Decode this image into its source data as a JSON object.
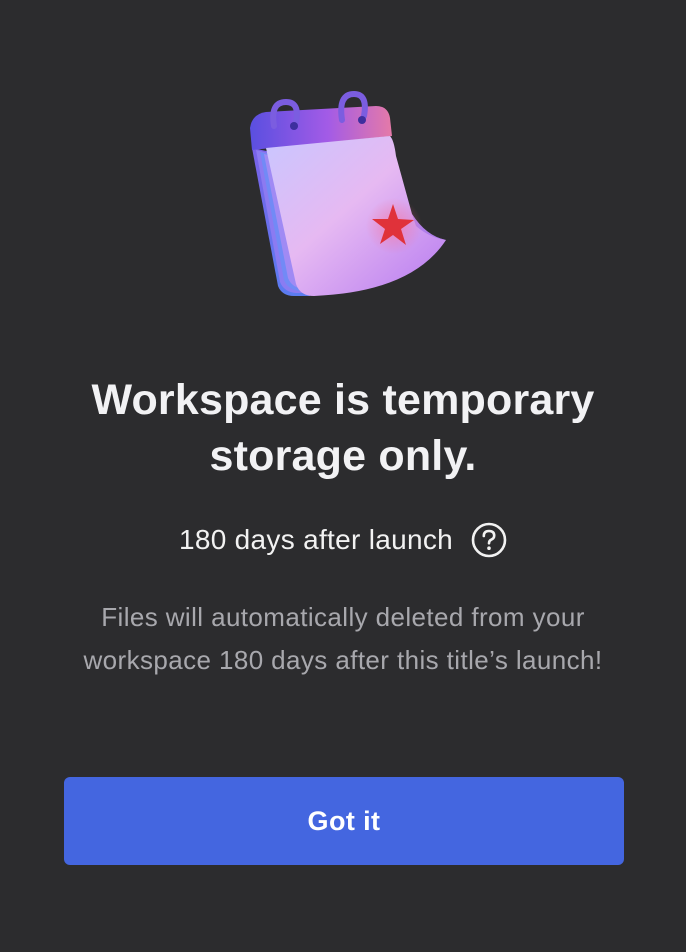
{
  "dialog": {
    "illustration_icon": "calendar-icon",
    "title": "Workspace is temporary storage only.",
    "subtitle": "180 days after launch",
    "help_icon": "question-circle-icon",
    "description": "Files will automatically deleted from your workspace 180 days after this title’s launch!",
    "primary_button_label": "Got it"
  },
  "colors": {
    "background": "#2c2c2e",
    "primary_button": "#4466e0",
    "title_text": "#f2f2f4",
    "description_text": "#a8a8ad",
    "calendar_star": "#e0323a"
  }
}
